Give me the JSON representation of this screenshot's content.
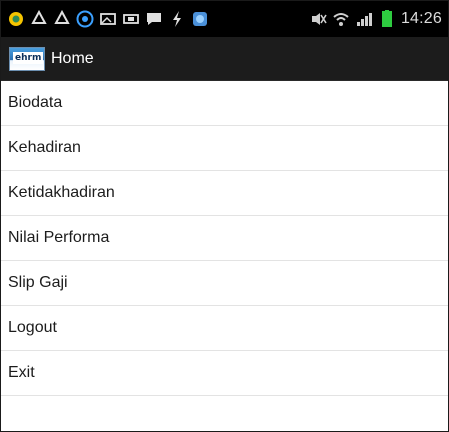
{
  "status_bar": {
    "time": "14:26",
    "icons": [
      "app-notification-icon",
      "recycle-icon",
      "recycle-icon",
      "badge-icon",
      "image-icon",
      "media-icon",
      "chat-icon",
      "usb-icon",
      "app-icon",
      "mute-icon",
      "wifi-icon",
      "signal-icon",
      "battery-icon"
    ],
    "battery_color": "#2ecc40"
  },
  "action_bar": {
    "logo_text": "ehrm",
    "title": "Home"
  },
  "menu": {
    "items": [
      {
        "label": "Biodata"
      },
      {
        "label": "Kehadiran"
      },
      {
        "label": "Ketidakhadiran"
      },
      {
        "label": "Nilai Performa"
      },
      {
        "label": "Slip Gaji"
      },
      {
        "label": "Logout"
      },
      {
        "label": "Exit"
      }
    ]
  }
}
